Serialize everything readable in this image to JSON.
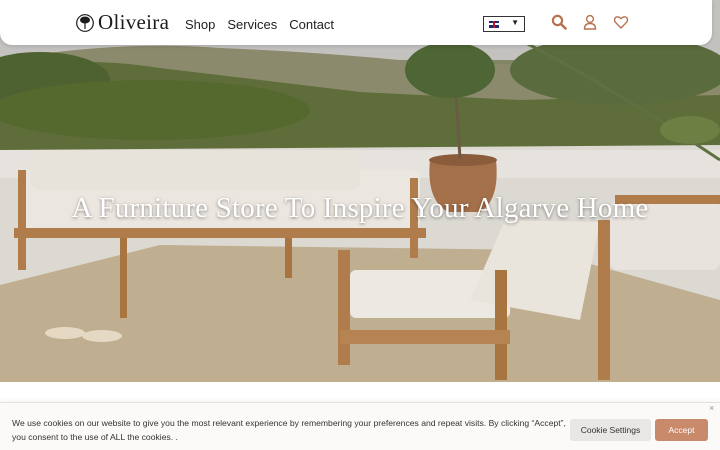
{
  "header": {
    "logo_text": "Oliveira",
    "nav": [
      "Shop",
      "Services",
      "Contact"
    ],
    "language": {
      "selected": "en",
      "flag": "uk-flag-icon",
      "caret": "▼"
    },
    "icons": [
      "search-icon",
      "user-icon",
      "heart-icon"
    ],
    "accent_color": "#b8714f"
  },
  "hero": {
    "title": "A Furniture Store To Inspire Your Algarve Home"
  },
  "cookie": {
    "text": "We use cookies on our website to give you the most relevant experience by remembering your preferences and repeat visits. By clicking “Accept”, you consent to the use of ALL the cookies. .",
    "settings_label": "Cookie Settings",
    "accept_label": "Accept",
    "close_label": "×",
    "accept_color": "#c9896b"
  }
}
